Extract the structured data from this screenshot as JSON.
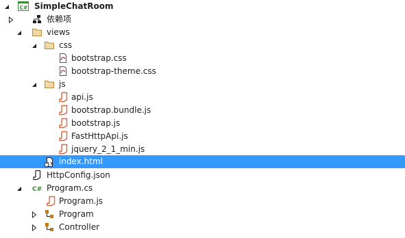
{
  "tree": {
    "items": [
      {
        "label": "SimpleChatRoom",
        "icon": "csharp-project-icon"
      },
      {
        "label": "依赖项",
        "icon": "dependencies-icon"
      },
      {
        "label": "views",
        "icon": "folder-icon"
      },
      {
        "label": "css",
        "icon": "folder-icon"
      },
      {
        "label": "bootstrap.css",
        "icon": "css-file-icon"
      },
      {
        "label": "bootstrap-theme.css",
        "icon": "css-file-icon"
      },
      {
        "label": "js",
        "icon": "folder-icon"
      },
      {
        "label": "api.js",
        "icon": "js-file-icon"
      },
      {
        "label": "bootstrap.bundle.js",
        "icon": "js-file-icon"
      },
      {
        "label": "bootstrap.js",
        "icon": "js-file-icon"
      },
      {
        "label": "FastHttpApi.js",
        "icon": "js-file-icon"
      },
      {
        "label": "jquery_2_1_min.js",
        "icon": "js-file-icon"
      },
      {
        "label": "index.html",
        "icon": "html-file-icon",
        "selected": true
      },
      {
        "label": "HttpConfig.json",
        "icon": "json-file-icon"
      },
      {
        "label": "Program.cs",
        "icon": "csharp-file-icon"
      },
      {
        "label": "Program.js",
        "icon": "js-file-icon"
      },
      {
        "label": "Program",
        "icon": "class-icon"
      },
      {
        "label": "Controller",
        "icon": "class-icon"
      }
    ]
  },
  "colors": {
    "selection": "#3399ff",
    "csharp": "#388a34",
    "folder": "#dcb67a",
    "js": "#d9653a"
  }
}
